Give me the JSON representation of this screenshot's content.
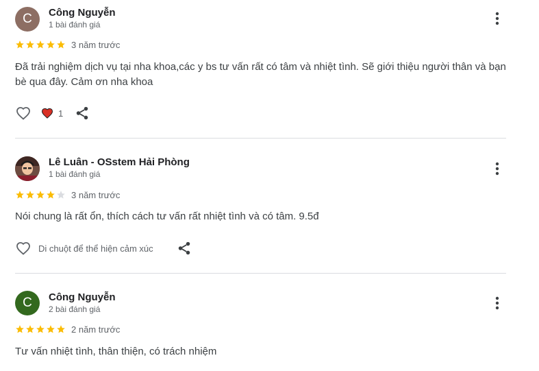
{
  "colors": {
    "star_filled": "#fbbc04",
    "star_empty": "#dadce0",
    "heart_reaction": "#d93025",
    "avatar_brown": "#8d6e63",
    "avatar_green": "#33691e"
  },
  "reviews": [
    {
      "avatar_letter": "C",
      "name": "Công Nguyễn",
      "review_count": "1 bài đánh giá",
      "rating": 5,
      "time": "3 năm trước",
      "text": "Đã trải nghiệm dịch vụ tại nha khoa,các y bs tư vấn rất có tâm và nhiệt tình. Sẽ giới thiệu người thân và bạn bè qua đây. Cảm ơn nha khoa",
      "like_count": "1"
    },
    {
      "avatar_letter": "",
      "name": "Lê Luân - OSstem Hải Phòng",
      "review_count": "1 bài đánh giá",
      "rating": 4,
      "time": "3 năm trước",
      "text": "Nói chung là rất ổn, thích cách tư vấn rất nhiệt tình và có tâm. 9.5đ",
      "hover_hint": "Di chuột để thể hiện cảm xúc"
    },
    {
      "avatar_letter": "C",
      "name": "Công Nguyễn",
      "review_count": "2 bài đánh giá",
      "rating": 5,
      "time": "2 năm trước",
      "text": "Tư vấn nhiệt tình, thân thiện, có trách nhiệm"
    }
  ]
}
